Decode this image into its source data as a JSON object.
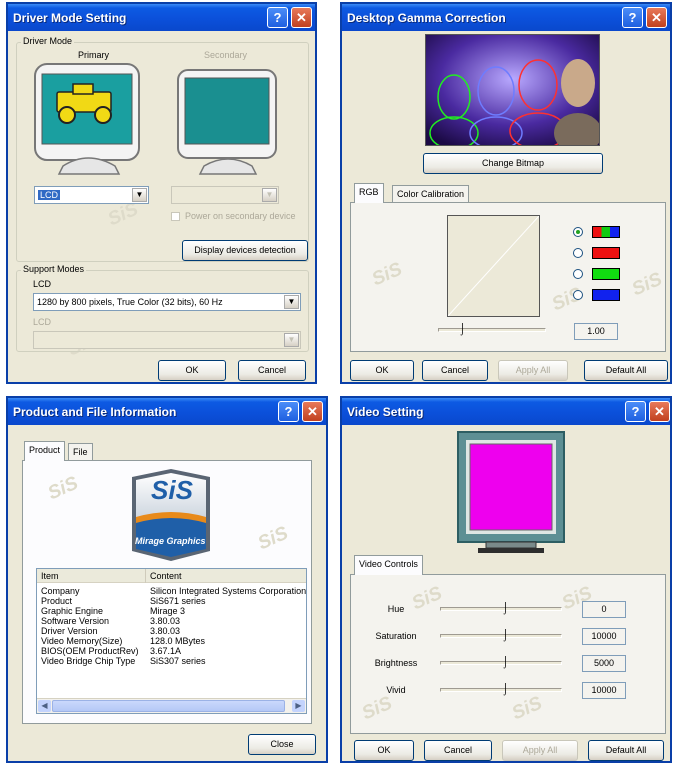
{
  "driver_mode": {
    "title": "Driver Mode Setting",
    "group_label": "Driver Mode",
    "primary_label": "Primary",
    "secondary_label": "Secondary",
    "primary_device": "LCD",
    "power_on_secondary_label": "Power on secondary device",
    "detect_button": "Display devices detection",
    "support_modes_label": "Support Modes",
    "primary_mode_label": "LCD",
    "primary_mode": "1280 by 800 pixels, True Color (32 bits), 60 Hz",
    "secondary_mode_label": "LCD",
    "ok_button": "OK",
    "cancel_button": "Cancel"
  },
  "gamma": {
    "title": "Desktop Gamma Correction",
    "change_bitmap_button": "Change Bitmap",
    "tabs": [
      "RGB",
      "Color Calibration"
    ],
    "gamma_value": "1.00",
    "channels": [
      {
        "name": "all",
        "color": "#2d8e2d",
        "selected": true
      },
      {
        "name": "red",
        "color": "#ee1111",
        "selected": false
      },
      {
        "name": "green",
        "color": "#11dd11",
        "selected": false
      },
      {
        "name": "blue",
        "color": "#1122ee",
        "selected": false
      }
    ],
    "ok_button": "OK",
    "cancel_button": "Cancel",
    "apply_all_button": "Apply All",
    "default_all_button": "Default All"
  },
  "product_info": {
    "title": "Product and File Information",
    "tabs": [
      "Product",
      "File"
    ],
    "logo_text": "SiS",
    "logo_subtitle": "Mirage Graphics",
    "columns": [
      "Item",
      "Content"
    ],
    "rows": [
      {
        "item": "Company",
        "content": "Silicon Integrated Systems Corporation"
      },
      {
        "item": "Product",
        "content": "SiS671 series"
      },
      {
        "item": "Graphic Engine",
        "content": "Mirage 3"
      },
      {
        "item": "Software Version",
        "content": "3.80.03"
      },
      {
        "item": "Driver Version",
        "content": "3.80.03"
      },
      {
        "item": "Video Memory(Size)",
        "content": "128.0 MBytes"
      },
      {
        "item": "BIOS(OEM ProductRev)",
        "content": "3.67.1A"
      },
      {
        "item": "Video Bridge Chip Type",
        "content": "SiS307 series"
      }
    ],
    "close_button": "Close"
  },
  "video": {
    "title": "Video Setting",
    "tab": "Video Controls",
    "preview_color": "#ee00ee",
    "controls": [
      {
        "label": "Hue",
        "value": "0"
      },
      {
        "label": "Saturation",
        "value": "10000"
      },
      {
        "label": "Brightness",
        "value": "5000"
      },
      {
        "label": "Vivid",
        "value": "10000"
      }
    ],
    "ok_button": "OK",
    "cancel_button": "Cancel",
    "apply_all_button": "Apply All",
    "default_all_button": "Default All"
  },
  "watermark_text": "SiS"
}
